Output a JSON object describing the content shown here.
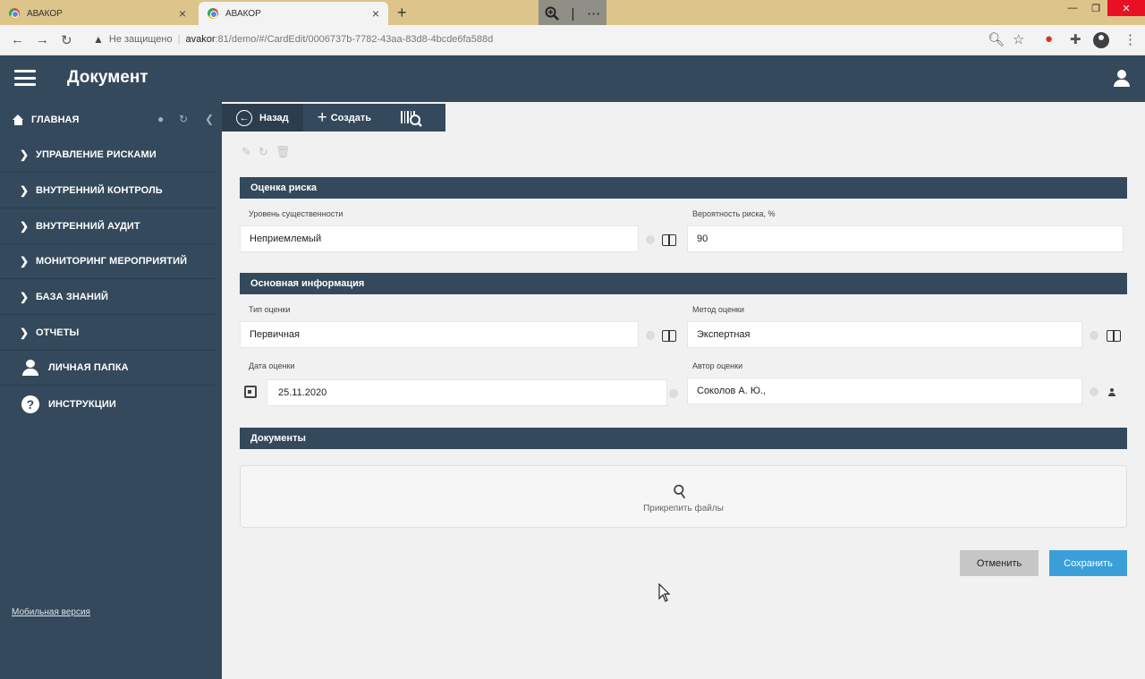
{
  "browser": {
    "tabs": [
      {
        "title": "АВАКОР",
        "close": "×"
      },
      {
        "title": "АВАКОР",
        "close": "×"
      }
    ],
    "new_tab": "+",
    "zoom_icon": "zoom-in-icon",
    "more": "⋯",
    "address": {
      "security_label": "Не защищено",
      "host": "avakor",
      "path": ":81/demo/#/CardEdit/0006737b-7782-43aa-83d8-4bcde6fa588d"
    }
  },
  "header": {
    "title": "Документ"
  },
  "sidebar": {
    "home_label": "ГЛАВНАЯ",
    "items": [
      {
        "label": "УПРАВЛЕНИЕ РИСКАМИ"
      },
      {
        "label": "ВНУТРЕННИЙ КОНТРОЛЬ"
      },
      {
        "label": "ВНУТРЕННИЙ АУДИТ"
      },
      {
        "label": "МОНИТОРИНГ МЕРОПРИЯТИЙ"
      },
      {
        "label": "БАЗА ЗНАНИЙ"
      },
      {
        "label": "ОТЧЕТЫ"
      },
      {
        "label": "ЛИЧНАЯ ПАПКА"
      },
      {
        "label": "ИНСТРУКЦИИ"
      }
    ],
    "mobile_link": "Мобильная версия"
  },
  "toolbar": {
    "back_label": "Назад",
    "create_label": "Создать"
  },
  "risk_section": {
    "title": "Оценка риска",
    "significance_label": "Уровень существенности",
    "significance_value": "Неприемлемый",
    "probability_label": "Вероятность риска, %",
    "probability_value": "90"
  },
  "main_section": {
    "title": "Основная информация",
    "type_label": "Тип оценки",
    "type_value": "Первичная",
    "method_label": "Метод оценки",
    "method_value": "Экспертная",
    "date_label": "Дата оценки",
    "date_value": "25.11.2020",
    "author_label": "Автор оценки",
    "author_value": "Соколов А. Ю.,"
  },
  "documents_section": {
    "title": "Документы",
    "attach_label": "Прикрепить файлы"
  },
  "actions": {
    "cancel_label": "Отменить",
    "save_label": "Сохранить"
  },
  "colors": {
    "primary_dark": "#34495b",
    "save_button": "#3a9fd8",
    "cancel_button": "#c6c6c6"
  }
}
